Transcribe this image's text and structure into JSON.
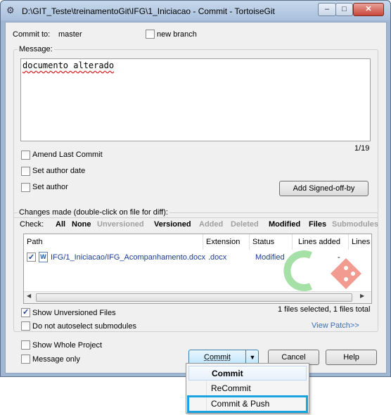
{
  "window": {
    "title": "D:\\GIT_Teste\\treinamentoGit\\IFG\\1_Iniciacao - Commit - TortoiseGit",
    "minimize_glyph": "–",
    "maximize_glyph": "□",
    "close_glyph": "✕"
  },
  "commit_to": {
    "label": "Commit to:",
    "branch": "master",
    "new_branch_label": "new branch"
  },
  "message": {
    "label": "Message:",
    "text": "documento alterado",
    "counter": "1/19"
  },
  "options": {
    "amend_label": "Amend Last Commit",
    "author_date_label": "Set author date",
    "author_label": "Set author",
    "signed_off_button": "Add Signed-off-by"
  },
  "changes": {
    "label": "Changes made (double-click on file for diff):",
    "check_label": "Check:",
    "filters": [
      {
        "label": "All",
        "enabled": true
      },
      {
        "label": "None",
        "enabled": true
      },
      {
        "label": "Unversioned",
        "enabled": false
      },
      {
        "label": "Versioned",
        "enabled": true
      },
      {
        "label": "Added",
        "enabled": false
      },
      {
        "label": "Deleted",
        "enabled": false
      },
      {
        "label": "Modified",
        "enabled": true
      },
      {
        "label": "Files",
        "enabled": true
      },
      {
        "label": "Submodules",
        "enabled": false
      }
    ],
    "columns": [
      "Path",
      "Extension",
      "Status",
      "Lines added",
      "Lines"
    ],
    "rows": [
      {
        "checked": true,
        "path": "IFG/1_Iniciacao/IFG_Acompanhamento.docx",
        "extension": ".docx",
        "status": "Modified",
        "lines_added": "-"
      }
    ],
    "summary": "1 files selected, 1 files total",
    "view_patch": "View Patch>>"
  },
  "bottom_options": {
    "show_unversioned": "Show Unversioned Files",
    "no_autoselect": "Do not autoselect submodules",
    "show_whole_project": "Show Whole Project",
    "message_only": "Message only"
  },
  "buttons": {
    "commit": "Commit",
    "cancel": "Cancel",
    "help": "Help"
  },
  "dropdown_menu": {
    "items": [
      "Commit",
      "ReCommit",
      "Commit & Push"
    ],
    "highlighted": "Commit & Push"
  },
  "colors": {
    "highlight_border": "#1aa3e1",
    "link": "#3a6fb5",
    "disabled_filter": "#a0a0a0"
  }
}
